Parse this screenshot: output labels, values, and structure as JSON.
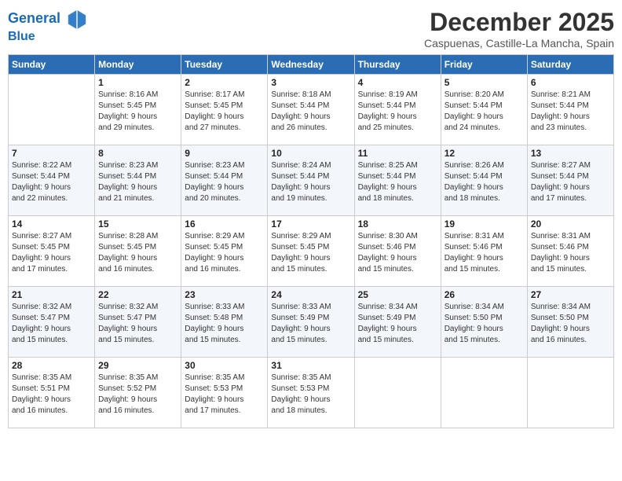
{
  "header": {
    "logo_line1": "General",
    "logo_line2": "Blue",
    "month_title": "December 2025",
    "subtitle": "Caspuenas, Castille-La Mancha, Spain"
  },
  "days_of_week": [
    "Sunday",
    "Monday",
    "Tuesday",
    "Wednesday",
    "Thursday",
    "Friday",
    "Saturday"
  ],
  "weeks": [
    [
      {
        "day": "",
        "sunrise": "",
        "sunset": "",
        "daylight": ""
      },
      {
        "day": "1",
        "sunrise": "Sunrise: 8:16 AM",
        "sunset": "Sunset: 5:45 PM",
        "daylight": "Daylight: 9 hours and 29 minutes."
      },
      {
        "day": "2",
        "sunrise": "Sunrise: 8:17 AM",
        "sunset": "Sunset: 5:45 PM",
        "daylight": "Daylight: 9 hours and 27 minutes."
      },
      {
        "day": "3",
        "sunrise": "Sunrise: 8:18 AM",
        "sunset": "Sunset: 5:44 PM",
        "daylight": "Daylight: 9 hours and 26 minutes."
      },
      {
        "day": "4",
        "sunrise": "Sunrise: 8:19 AM",
        "sunset": "Sunset: 5:44 PM",
        "daylight": "Daylight: 9 hours and 25 minutes."
      },
      {
        "day": "5",
        "sunrise": "Sunrise: 8:20 AM",
        "sunset": "Sunset: 5:44 PM",
        "daylight": "Daylight: 9 hours and 24 minutes."
      },
      {
        "day": "6",
        "sunrise": "Sunrise: 8:21 AM",
        "sunset": "Sunset: 5:44 PM",
        "daylight": "Daylight: 9 hours and 23 minutes."
      }
    ],
    [
      {
        "day": "7",
        "sunrise": "Sunrise: 8:22 AM",
        "sunset": "Sunset: 5:44 PM",
        "daylight": "Daylight: 9 hours and 22 minutes."
      },
      {
        "day": "8",
        "sunrise": "Sunrise: 8:23 AM",
        "sunset": "Sunset: 5:44 PM",
        "daylight": "Daylight: 9 hours and 21 minutes."
      },
      {
        "day": "9",
        "sunrise": "Sunrise: 8:23 AM",
        "sunset": "Sunset: 5:44 PM",
        "daylight": "Daylight: 9 hours and 20 minutes."
      },
      {
        "day": "10",
        "sunrise": "Sunrise: 8:24 AM",
        "sunset": "Sunset: 5:44 PM",
        "daylight": "Daylight: 9 hours and 19 minutes."
      },
      {
        "day": "11",
        "sunrise": "Sunrise: 8:25 AM",
        "sunset": "Sunset: 5:44 PM",
        "daylight": "Daylight: 9 hours and 18 minutes."
      },
      {
        "day": "12",
        "sunrise": "Sunrise: 8:26 AM",
        "sunset": "Sunset: 5:44 PM",
        "daylight": "Daylight: 9 hours and 18 minutes."
      },
      {
        "day": "13",
        "sunrise": "Sunrise: 8:27 AM",
        "sunset": "Sunset: 5:44 PM",
        "daylight": "Daylight: 9 hours and 17 minutes."
      }
    ],
    [
      {
        "day": "14",
        "sunrise": "Sunrise: 8:27 AM",
        "sunset": "Sunset: 5:45 PM",
        "daylight": "Daylight: 9 hours and 17 minutes."
      },
      {
        "day": "15",
        "sunrise": "Sunrise: 8:28 AM",
        "sunset": "Sunset: 5:45 PM",
        "daylight": "Daylight: 9 hours and 16 minutes."
      },
      {
        "day": "16",
        "sunrise": "Sunrise: 8:29 AM",
        "sunset": "Sunset: 5:45 PM",
        "daylight": "Daylight: 9 hours and 16 minutes."
      },
      {
        "day": "17",
        "sunrise": "Sunrise: 8:29 AM",
        "sunset": "Sunset: 5:45 PM",
        "daylight": "Daylight: 9 hours and 15 minutes."
      },
      {
        "day": "18",
        "sunrise": "Sunrise: 8:30 AM",
        "sunset": "Sunset: 5:46 PM",
        "daylight": "Daylight: 9 hours and 15 minutes."
      },
      {
        "day": "19",
        "sunrise": "Sunrise: 8:31 AM",
        "sunset": "Sunset: 5:46 PM",
        "daylight": "Daylight: 9 hours and 15 minutes."
      },
      {
        "day": "20",
        "sunrise": "Sunrise: 8:31 AM",
        "sunset": "Sunset: 5:46 PM",
        "daylight": "Daylight: 9 hours and 15 minutes."
      }
    ],
    [
      {
        "day": "21",
        "sunrise": "Sunrise: 8:32 AM",
        "sunset": "Sunset: 5:47 PM",
        "daylight": "Daylight: 9 hours and 15 minutes."
      },
      {
        "day": "22",
        "sunrise": "Sunrise: 8:32 AM",
        "sunset": "Sunset: 5:47 PM",
        "daylight": "Daylight: 9 hours and 15 minutes."
      },
      {
        "day": "23",
        "sunrise": "Sunrise: 8:33 AM",
        "sunset": "Sunset: 5:48 PM",
        "daylight": "Daylight: 9 hours and 15 minutes."
      },
      {
        "day": "24",
        "sunrise": "Sunrise: 8:33 AM",
        "sunset": "Sunset: 5:49 PM",
        "daylight": "Daylight: 9 hours and 15 minutes."
      },
      {
        "day": "25",
        "sunrise": "Sunrise: 8:34 AM",
        "sunset": "Sunset: 5:49 PM",
        "daylight": "Daylight: 9 hours and 15 minutes."
      },
      {
        "day": "26",
        "sunrise": "Sunrise: 8:34 AM",
        "sunset": "Sunset: 5:50 PM",
        "daylight": "Daylight: 9 hours and 15 minutes."
      },
      {
        "day": "27",
        "sunrise": "Sunrise: 8:34 AM",
        "sunset": "Sunset: 5:50 PM",
        "daylight": "Daylight: 9 hours and 16 minutes."
      }
    ],
    [
      {
        "day": "28",
        "sunrise": "Sunrise: 8:35 AM",
        "sunset": "Sunset: 5:51 PM",
        "daylight": "Daylight: 9 hours and 16 minutes."
      },
      {
        "day": "29",
        "sunrise": "Sunrise: 8:35 AM",
        "sunset": "Sunset: 5:52 PM",
        "daylight": "Daylight: 9 hours and 16 minutes."
      },
      {
        "day": "30",
        "sunrise": "Sunrise: 8:35 AM",
        "sunset": "Sunset: 5:53 PM",
        "daylight": "Daylight: 9 hours and 17 minutes."
      },
      {
        "day": "31",
        "sunrise": "Sunrise: 8:35 AM",
        "sunset": "Sunset: 5:53 PM",
        "daylight": "Daylight: 9 hours and 18 minutes."
      },
      {
        "day": "",
        "sunrise": "",
        "sunset": "",
        "daylight": ""
      },
      {
        "day": "",
        "sunrise": "",
        "sunset": "",
        "daylight": ""
      },
      {
        "day": "",
        "sunrise": "",
        "sunset": "",
        "daylight": ""
      }
    ]
  ]
}
